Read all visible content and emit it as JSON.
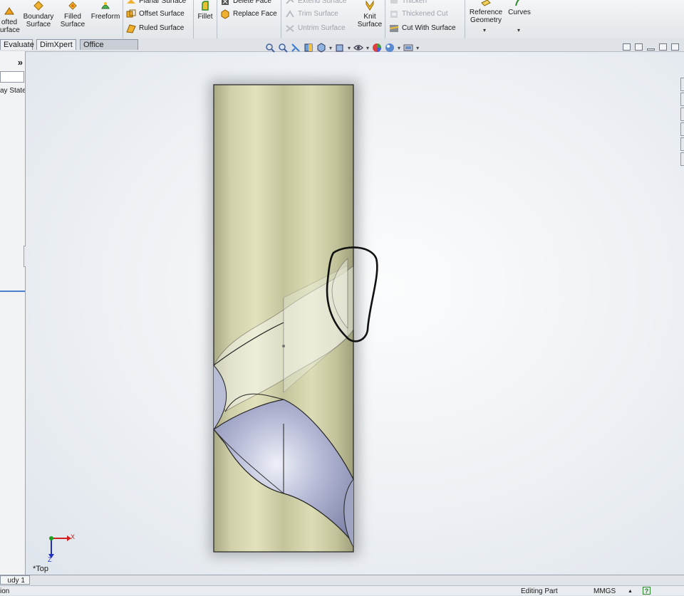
{
  "ribbon": {
    "lofted": {
      "line1": "ofted",
      "line2": "urface"
    },
    "boundary": {
      "line1": "Boundary",
      "line2": "Surface"
    },
    "filled": {
      "line1": "Filled",
      "line2": "Surface"
    },
    "freeform": "Freeform",
    "planar_surface": "Planar Surface",
    "offset_surface": "Offset Surface",
    "ruled_surface": "Ruled Surface",
    "fillet": "Fillet",
    "delete_face": "Delete Face",
    "replace_face": "Replace Face",
    "extend_surface": "Extend Surface",
    "trim_surface": "Trim Surface",
    "untrim_surface": "Untrim Surface",
    "knit": {
      "line1": "Knit",
      "line2": "Surface"
    },
    "thicken": "Thicken",
    "thickened_cut": "Thickened Cut",
    "cut_with_surface": "Cut With Surface",
    "reference": {
      "line1": "Reference",
      "line2": "Geometry"
    },
    "curves": "Curves"
  },
  "tabs": [
    "Evaluate",
    "DimXpert",
    "Office Products"
  ],
  "left_panel": {
    "chevron": "»",
    "display_state_label": "ay State"
  },
  "viewport": {
    "view_label": "*Top",
    "triad_x": "X",
    "triad_z": "Z"
  },
  "bottom": {
    "sheet_tab": "udy 1",
    "status_left": "ion",
    "status_mode": "Editing Part",
    "units": "MMGS",
    "units_caret": "▲",
    "help": "?"
  },
  "colors": {
    "cylinder": "#c9c9a0",
    "surface_blue": "#a6abc9",
    "annotation": "#111111"
  }
}
